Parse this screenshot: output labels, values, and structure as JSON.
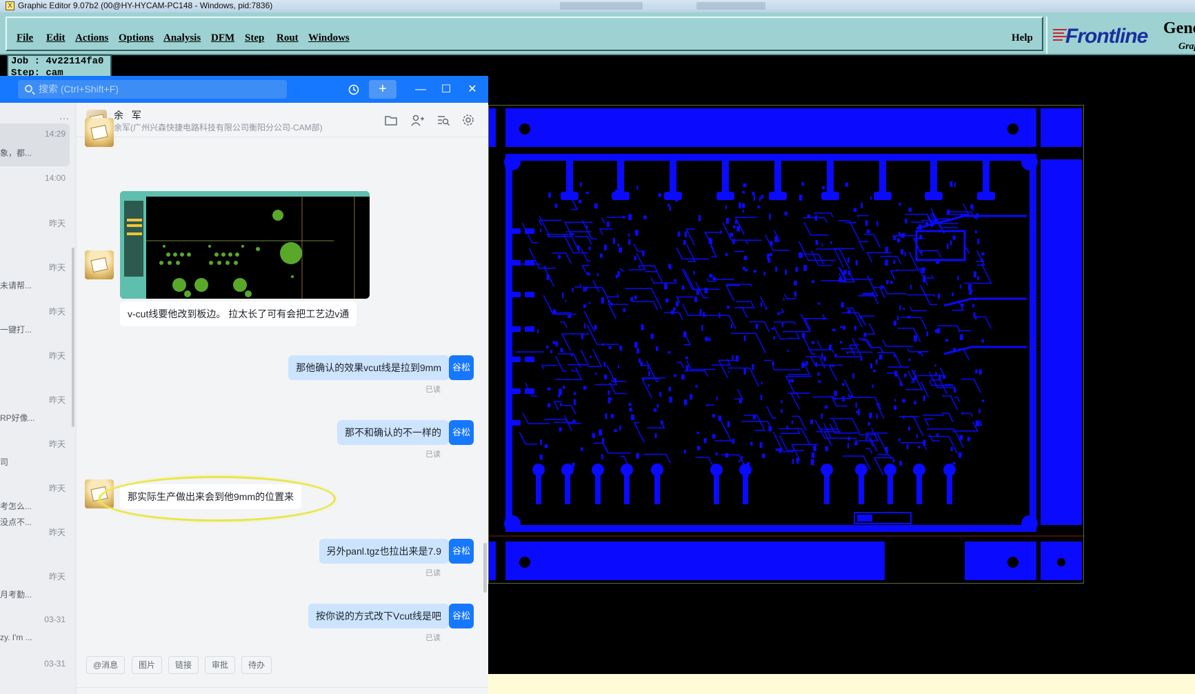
{
  "cam": {
    "title": "Graphic Editor 9.07b2 (00@HY-HYCAM-PC148 - Windows, pid:7836)",
    "menu": [
      "File",
      "Edit",
      "Actions",
      "Options",
      "Analysis",
      "DFM",
      "Step",
      "Rout",
      "Windows"
    ],
    "help": "Help",
    "brand": {
      "logo": "Frontline",
      "product": "Gene",
      "subtitle": "Grap"
    },
    "job_line": "Job : 4v22114fa0",
    "step_line": "Step: cam",
    "colors": {
      "menu_bg": "#9ed2d2",
      "board": "#0a0aff",
      "background": "#000000"
    }
  },
  "chat": {
    "search_placeholder": "搜索 (Ctrl+Shift+F)",
    "header_buttons": {
      "history": "history-icon",
      "add": "+",
      "minimize": "—",
      "maximize": "☐",
      "close": "✕"
    },
    "sidebar": {
      "more": "···",
      "items": [
        {
          "time": "14:29",
          "snippet": "象，都..."
        },
        {
          "time": "14:00",
          "snippet": ""
        },
        {
          "time": "昨天",
          "snippet": ""
        },
        {
          "time": "昨天",
          "snippet": "未请帮..."
        },
        {
          "time": "昨天",
          "snippet": "一键打..."
        },
        {
          "time": "昨天",
          "snippet": ""
        },
        {
          "time": "昨天",
          "snippet": "RP好像..."
        },
        {
          "time": "昨天",
          "snippet": "司"
        },
        {
          "time": "昨天",
          "snippet": "考怎么..."
        },
        {
          "time": "",
          "snippet": "没点不..."
        },
        {
          "time": "昨天",
          "snippet": ""
        },
        {
          "time": "昨天",
          "snippet": "月考勤..."
        },
        {
          "time": "03-31",
          "snippet": "zy. I'm ..."
        },
        {
          "time": "03-31",
          "snippet": ""
        }
      ]
    },
    "contact": {
      "name": "余 军",
      "org": "余军(广州兴森快捷电路科技有限公司衡阳分公司-CAM部)"
    },
    "messages": [
      {
        "from": "other",
        "type": "image"
      },
      {
        "from": "other",
        "text": "v-cut线要他改到板边。 拉太长了可有会把工艺边v通"
      },
      {
        "from": "me",
        "text": "那他确认的效果vcut线是拉到9mm",
        "status": "已读"
      },
      {
        "from": "me",
        "text": "那不和确认的不一样的",
        "status": "已读"
      },
      {
        "from": "other",
        "text": "那实际生产做出来会到他9mm的位置来",
        "highlighted": true
      },
      {
        "from": "me",
        "text": "另外panl.tgz也拉出来是7.9",
        "status": "已读"
      },
      {
        "from": "me",
        "text": "按你说的方式改下Vcut线是吧",
        "status": "已读"
      }
    ],
    "me_avatar": "谷松",
    "quick_actions": [
      "@消息",
      "图片",
      "链接",
      "审批",
      "待办"
    ]
  }
}
